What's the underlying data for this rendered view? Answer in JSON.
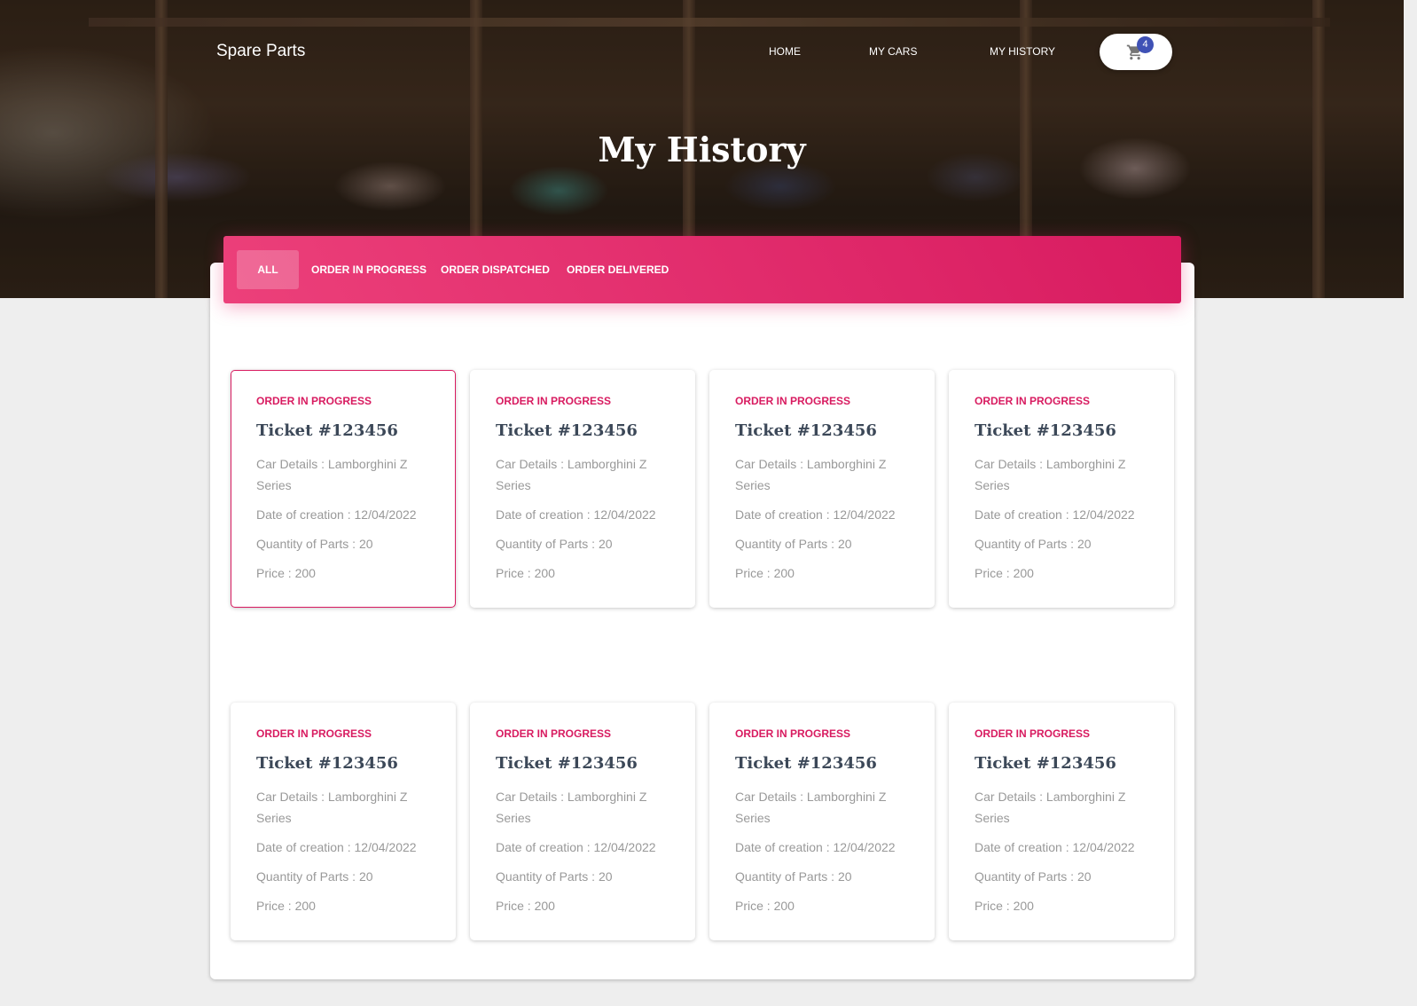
{
  "nav": {
    "brand": "Spare Parts",
    "links": [
      "HOME",
      "MY CARS",
      "MY HISTORY"
    ],
    "cart_count": "4"
  },
  "page": {
    "title": "My History"
  },
  "tabs": [
    {
      "label": "ALL",
      "active": true
    },
    {
      "label": "ORDER IN PROGRESS",
      "active": false
    },
    {
      "label": "ORDER DISPATCHED",
      "active": false
    },
    {
      "label": "ORDER DELIVERED",
      "active": false
    }
  ],
  "tickets": [
    {
      "status": "ORDER IN PROGRESS",
      "title": "Ticket #123456",
      "car": "Car Details : Lamborghini Z Series",
      "date": "Date of creation : 12/04/2022",
      "qty": "Quantity of Parts : 20",
      "price": "Price : 200"
    },
    {
      "status": "ORDER IN PROGRESS",
      "title": "Ticket #123456",
      "car": "Car Details : Lamborghini Z Series",
      "date": "Date of creation : 12/04/2022",
      "qty": "Quantity of Parts : 20",
      "price": "Price : 200"
    },
    {
      "status": "ORDER IN PROGRESS",
      "title": "Ticket #123456",
      "car": "Car Details : Lamborghini Z Series",
      "date": "Date of creation : 12/04/2022",
      "qty": "Quantity of Parts : 20",
      "price": "Price : 200"
    },
    {
      "status": "ORDER IN PROGRESS",
      "title": "Ticket #123456",
      "car": "Car Details : Lamborghini Z Series",
      "date": "Date of creation : 12/04/2022",
      "qty": "Quantity of Parts : 20",
      "price": "Price : 200"
    },
    {
      "status": "ORDER IN PROGRESS",
      "title": "Ticket #123456",
      "car": "Car Details : Lamborghini Z Series",
      "date": "Date of creation : 12/04/2022",
      "qty": "Quantity of Parts : 20",
      "price": "Price : 200"
    },
    {
      "status": "ORDER IN PROGRESS",
      "title": "Ticket #123456",
      "car": "Car Details : Lamborghini Z Series",
      "date": "Date of creation : 12/04/2022",
      "qty": "Quantity of Parts : 20",
      "price": "Price : 200"
    },
    {
      "status": "ORDER IN PROGRESS",
      "title": "Ticket #123456",
      "car": "Car Details : Lamborghini Z Series",
      "date": "Date of creation : 12/04/2022",
      "qty": "Quantity of Parts : 20",
      "price": "Price : 200"
    },
    {
      "status": "ORDER IN PROGRESS",
      "title": "Ticket #123456",
      "car": "Car Details : Lamborghini Z Series",
      "date": "Date of creation : 12/04/2022",
      "qty": "Quantity of Parts : 20",
      "price": "Price : 200"
    }
  ],
  "colors": {
    "accent": "#d81b60",
    "badge": "#3f51b5",
    "title_text": "#3c4858",
    "muted_text": "#999999"
  },
  "icons": {
    "cart": "shopping-cart-icon"
  }
}
